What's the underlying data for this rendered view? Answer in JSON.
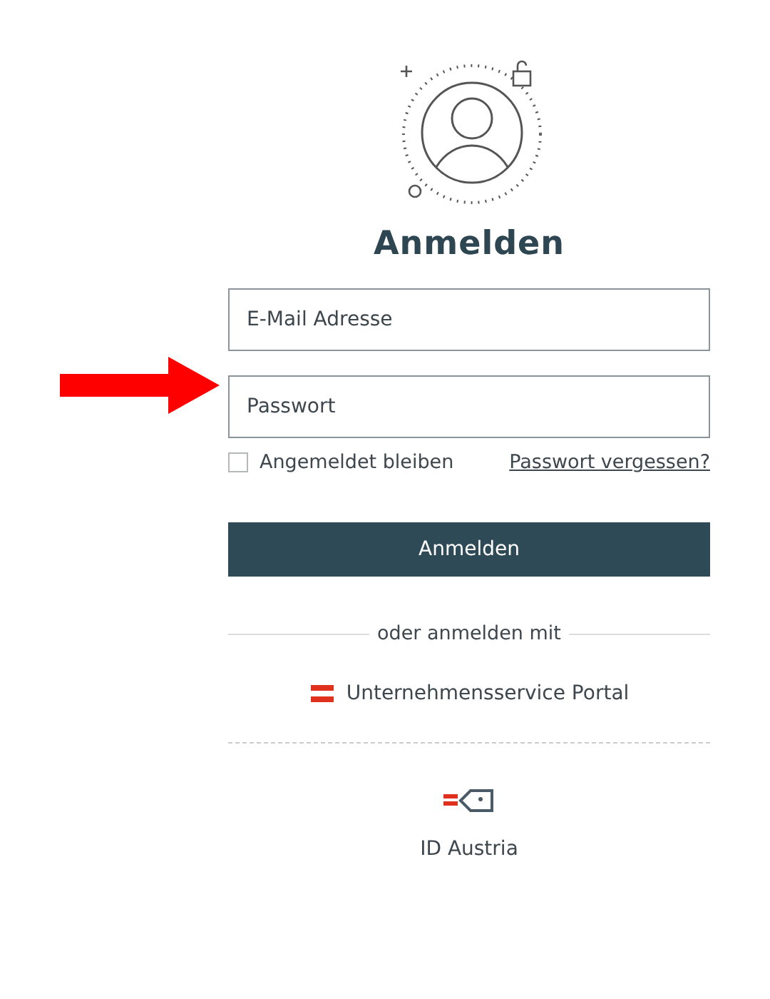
{
  "title": "Anmelden",
  "fields": [
    {
      "placeholder": "E-Mail Adresse"
    },
    {
      "placeholder": "Passwort"
    }
  ],
  "remember": {
    "label": "Angemeldet bleiben",
    "checked": false
  },
  "forgot_link": "Passwort vergessen?",
  "submit": "Anmelden",
  "divider": "oder anmelden mit",
  "providers": [
    {
      "kind": "usp",
      "label": "Unternehmensservice Portal"
    },
    {
      "kind": "id_austria",
      "label": "ID Austria"
    }
  ]
}
